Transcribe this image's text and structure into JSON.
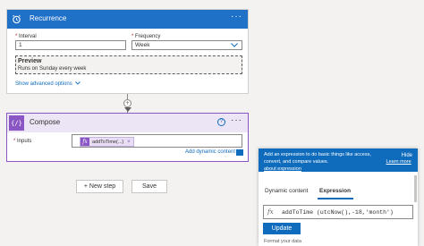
{
  "recurrence": {
    "title": "Recurrence",
    "menu": "···",
    "interval_label": "Interval",
    "interval_value": "1",
    "frequency_label": "Frequency",
    "frequency_value": "Week",
    "preview_title": "Preview",
    "preview_text": "Runs on Sunday every week",
    "advanced_link": "Show advanced options"
  },
  "compose": {
    "title": "Compose",
    "menu": "···",
    "inputs_label": "Inputs",
    "token_label": "addToTime(...)",
    "add_dynamic_link": "Add dynamic content"
  },
  "actions": {
    "new_step": "+ New step",
    "save": "Save"
  },
  "expression_panel": {
    "banner_text": "Add an expression to do basic things like access, convert, and compare values.",
    "learn_more": "Learn more about expression",
    "hide_label": "Hide",
    "tab_dynamic": "Dynamic content",
    "tab_expression": "Expression",
    "fx": "fx",
    "expression_value": "addToTime (utcNow(),-18,'month')",
    "update_label": "Update",
    "footer_text": "Format your data"
  },
  "colors": {
    "recurrence_header": "#1f70c7",
    "compose_accent": "#8a56c4",
    "primary_blue": "#0f6cbd"
  }
}
